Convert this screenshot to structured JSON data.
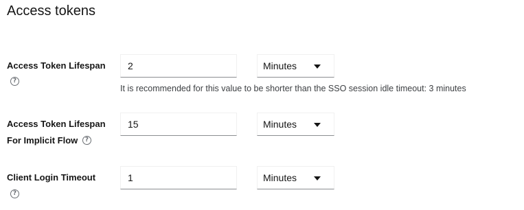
{
  "section": {
    "title": "Access tokens"
  },
  "fields": [
    {
      "label": "Access Token Lifespan",
      "value": "2",
      "unit": "Minutes",
      "helper": "It is recommended for this value to be shorter than the SSO session idle timeout: 3 minutes"
    },
    {
      "label_line1": "Access Token Lifespan",
      "label_line2": "For Implicit Flow",
      "value": "15",
      "unit": "Minutes"
    },
    {
      "label": "Client Login Timeout",
      "value": "1",
      "unit": "Minutes"
    }
  ],
  "icons": {
    "help": "question-circle-icon",
    "caret": "caret-down-icon"
  },
  "help_glyph": "?"
}
